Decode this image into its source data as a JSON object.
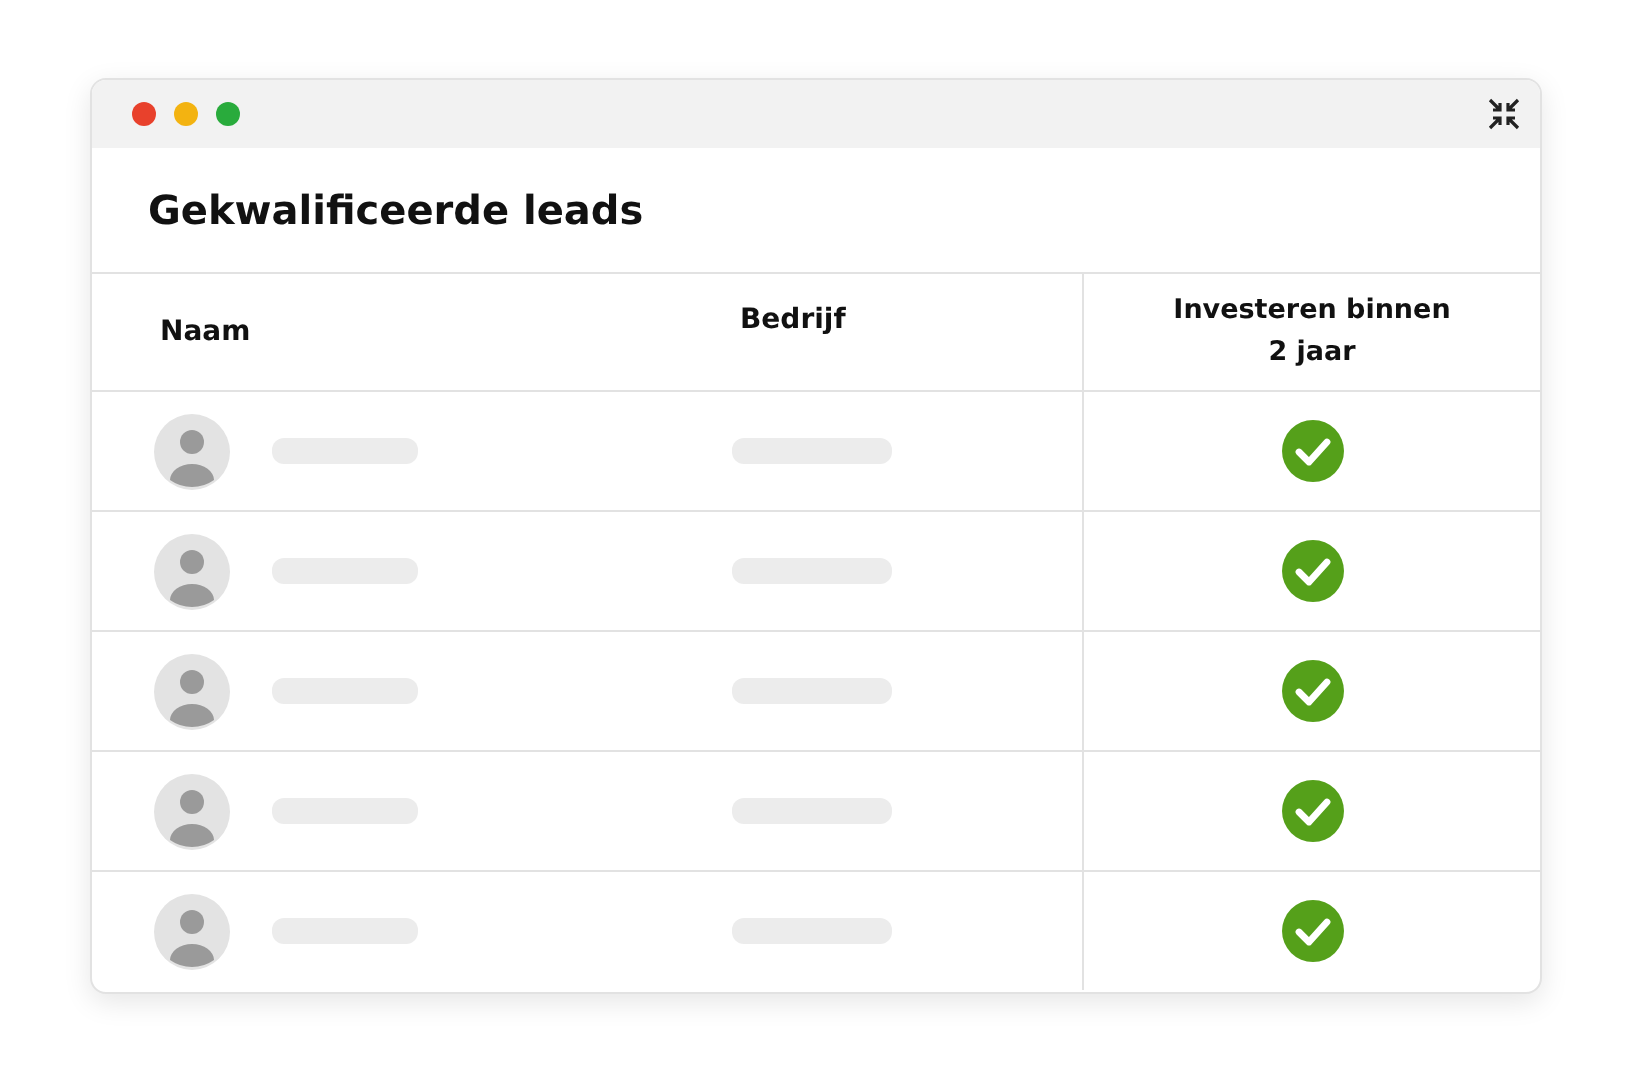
{
  "window": {
    "title": "Gekwalificeerde leads"
  },
  "table": {
    "columns": [
      "Naam",
      "Bedrijf",
      "Investeren binnen 2 jaar"
    ],
    "rows": [
      {
        "checked": true
      },
      {
        "checked": true
      },
      {
        "checked": true
      },
      {
        "checked": true
      },
      {
        "checked": true
      }
    ]
  }
}
